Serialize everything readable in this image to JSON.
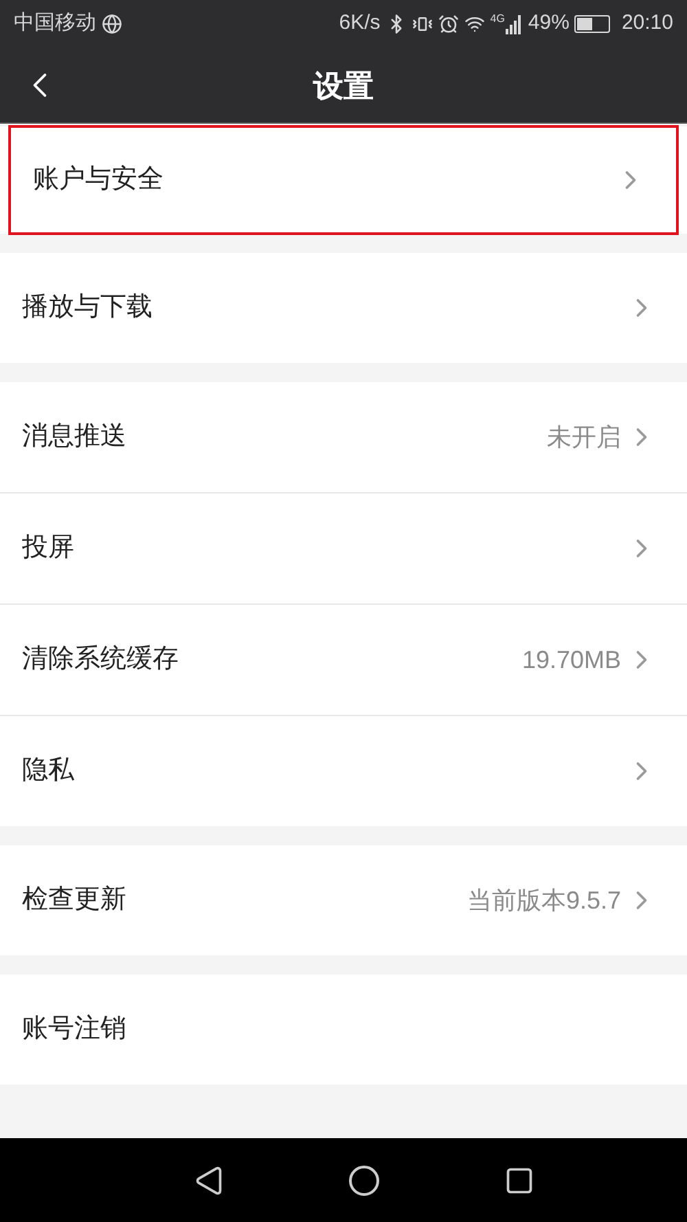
{
  "status_bar": {
    "carrier": "中国移动",
    "speed": "6K/s",
    "network": "4G",
    "battery": "49%",
    "time": "20:10"
  },
  "header": {
    "title": "设置"
  },
  "groups": [
    {
      "items": [
        {
          "label": "账户与安全",
          "chevron": true,
          "highlighted": true
        }
      ]
    },
    {
      "items": [
        {
          "label": "播放与下载",
          "chevron": true,
          "highlighted": false
        }
      ]
    },
    {
      "items": [
        {
          "label": "消息推送",
          "value": "未开启",
          "chevron": true,
          "highlighted": false
        },
        {
          "label": "投屏",
          "chevron": true,
          "highlighted": false
        },
        {
          "label": "清除系统缓存",
          "value": "19.70MB",
          "chevron": true,
          "highlighted": false
        },
        {
          "label": "隐私",
          "chevron": true,
          "highlighted": false
        }
      ]
    },
    {
      "items": [
        {
          "label": "检查更新",
          "value": "当前版本9.5.7",
          "chevron": true,
          "highlighted": false
        }
      ]
    },
    {
      "items": [
        {
          "label": "账号注销",
          "chevron": false,
          "highlighted": false
        }
      ]
    }
  ]
}
